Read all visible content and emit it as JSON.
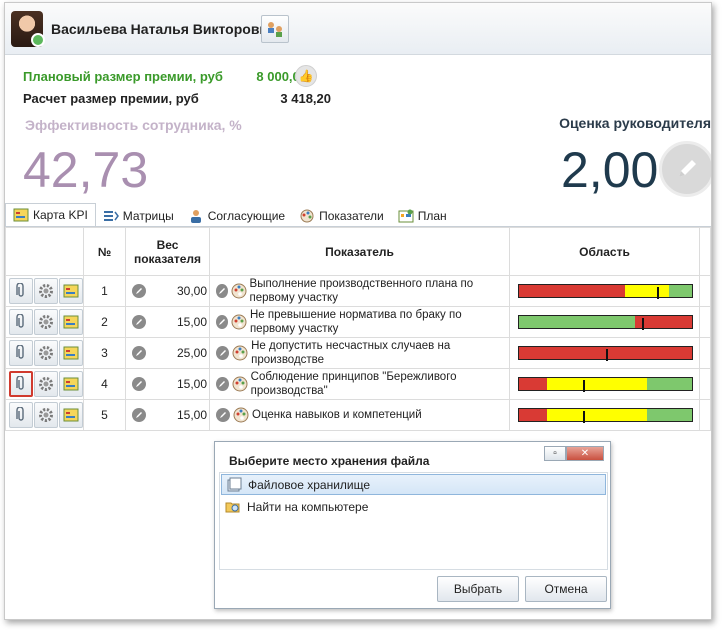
{
  "header": {
    "user_name": "Васильева Наталья Викторовна"
  },
  "bonus": {
    "planned_label": "Плановый размер премии, руб",
    "planned_value": "8 000,00",
    "calc_label": "Расчет размер премии, руб",
    "calc_value": "3 418,20"
  },
  "efficiency": {
    "label": "Эффективность сотрудника, %",
    "value": "42,73"
  },
  "manager": {
    "label": "Оценка руководителя",
    "value": "2,00"
  },
  "tabs": [
    {
      "label": "Карта KPI",
      "active": true
    },
    {
      "label": "Матрицы",
      "active": false
    },
    {
      "label": "Согласующие",
      "active": false
    },
    {
      "label": "Показатели",
      "active": false
    },
    {
      "label": "План",
      "active": false
    }
  ],
  "table": {
    "columns": {
      "num": "№",
      "weight": "Вес показателя",
      "indicator": "Показатель",
      "area": "Область"
    },
    "rows": [
      {
        "num": "1",
        "weight": "30,00",
        "indicator": "Выполнение производственного плана по первому участку",
        "scale": [
          {
            "color": "#d93a34",
            "frac": 0.61
          },
          {
            "color": "#ffff00",
            "frac": 0.26
          },
          {
            "color": "#7ec86d",
            "frac": 0.13
          }
        ],
        "marker": 0.8
      },
      {
        "num": "2",
        "weight": "15,00",
        "indicator": "Не превышение норматива по браку по первому участку",
        "scale": [
          {
            "color": "#7ec86d",
            "frac": 0.67
          },
          {
            "color": "#d93a34",
            "frac": 0.33
          }
        ],
        "marker": 0.71
      },
      {
        "num": "3",
        "weight": "25,00",
        "indicator": "Не допустить несчастных случаев на производстве",
        "scale": [
          {
            "color": "#d93a34",
            "frac": 1.0
          }
        ],
        "marker": 0.5
      },
      {
        "num": "4",
        "weight": "15,00",
        "indicator": "Соблюдение принципов \"Бережливого производства\"",
        "scale": [
          {
            "color": "#d93a34",
            "frac": 0.16
          },
          {
            "color": "#ffff00",
            "frac": 0.58
          },
          {
            "color": "#7ec86d",
            "frac": 0.26
          }
        ],
        "marker": 0.37
      },
      {
        "num": "5",
        "weight": "15,00",
        "indicator": "Оценка навыков и компетенций",
        "scale": [
          {
            "color": "#d93a34",
            "frac": 0.16
          },
          {
            "color": "#ffff00",
            "frac": 0.58
          },
          {
            "color": "#7ec86d",
            "frac": 0.26
          }
        ],
        "marker": 0.37
      }
    ]
  },
  "dialog": {
    "title": "Выберите место хранения файла",
    "items": [
      "Файловое хранилище",
      "Найти на компьютере"
    ],
    "ok_label": "Выбрать",
    "cancel_label": "Отмена"
  }
}
